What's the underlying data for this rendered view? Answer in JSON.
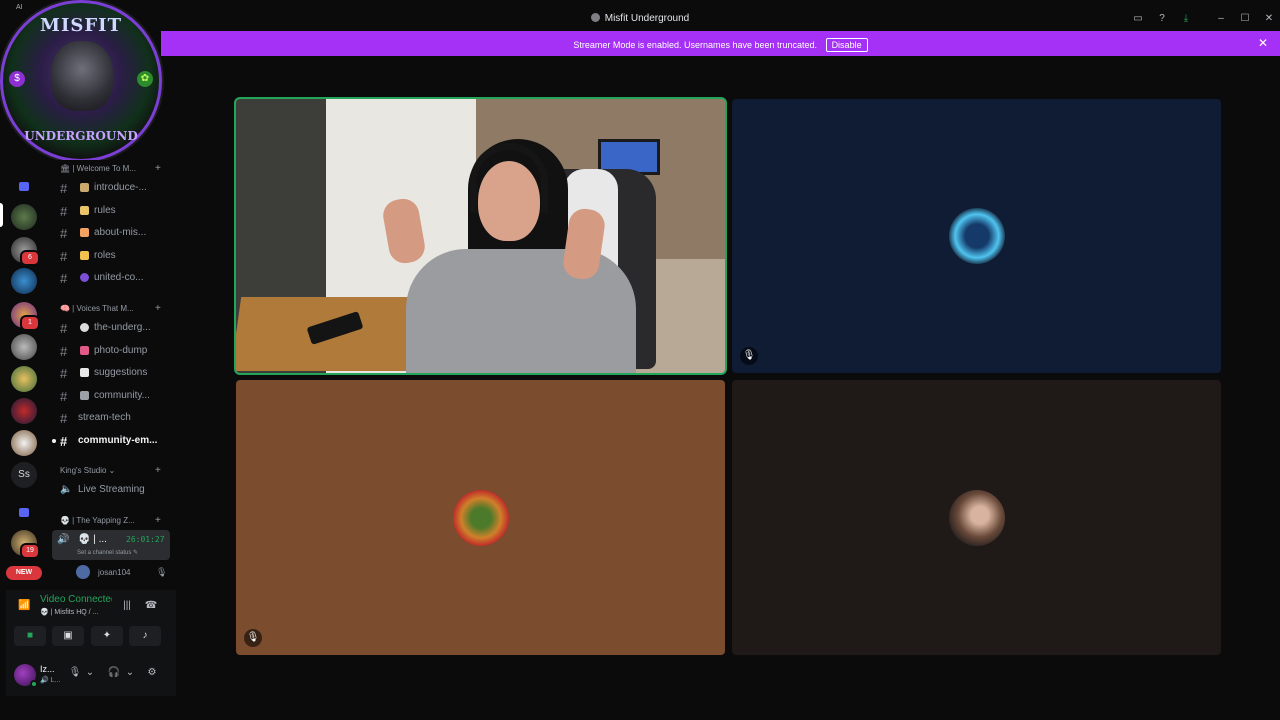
{
  "window": {
    "title": "Misfit Underground",
    "corner_label": "AI"
  },
  "banner": {
    "message": "Streamer Mode is enabled. Usernames have been truncated.",
    "disable_label": "Disable",
    "close": "✕"
  },
  "server_logo": {
    "top_text": "MISFIT",
    "bottom_text": "UNDERGROUND",
    "left_badge": "$",
    "right_badge": "✿"
  },
  "server_list": {
    "badges": [
      "6",
      "1",
      "19"
    ],
    "ss_label": "Ss",
    "new_label": "NEW"
  },
  "categories": [
    {
      "label": "🏛 | Welcome To M..."
    },
    {
      "label": "🧠 | Voices That M..."
    },
    {
      "label": "King's Studio ⌄"
    },
    {
      "label": "💀 | The Yapping Z..."
    }
  ],
  "channels": [
    {
      "label": "introduce-...",
      "emoji_color": "#c9a96e"
    },
    {
      "label": "rules",
      "emoji_color": "#e9c46a"
    },
    {
      "label": "about-mis...",
      "emoji_color": "#f4a261"
    },
    {
      "label": "roles",
      "emoji_color": "#f2c14e"
    },
    {
      "label": "united-co...",
      "emoji_color": "#7b4fd6"
    },
    {
      "label": "the-underg...",
      "emoji_color": "#dcdcdc"
    },
    {
      "label": "photo-dump",
      "emoji_color": "#e05a87"
    },
    {
      "label": "suggestions",
      "emoji_color": "#e8e8e8"
    },
    {
      "label": "community...",
      "emoji_color": "#9aa0a6"
    },
    {
      "label": "stream-tech"
    },
    {
      "label": "community-em..."
    }
  ],
  "voice_channels": {
    "live_streaming": "Live Streaming",
    "active_name": "💀 | ...",
    "active_time": "26:01:27",
    "active_status": "Set a channel status ✎",
    "member_name": "josan104"
  },
  "voice_panel": {
    "connected": "Video Connected",
    "server": "💀 | Misfits HQ / ..."
  },
  "user_panel": {
    "name": "Iz...",
    "status": "🔊 L..."
  },
  "tiles": {
    "colors": [
      "#0f1c33",
      "#7b4c2e",
      "#1f1a17"
    ]
  }
}
